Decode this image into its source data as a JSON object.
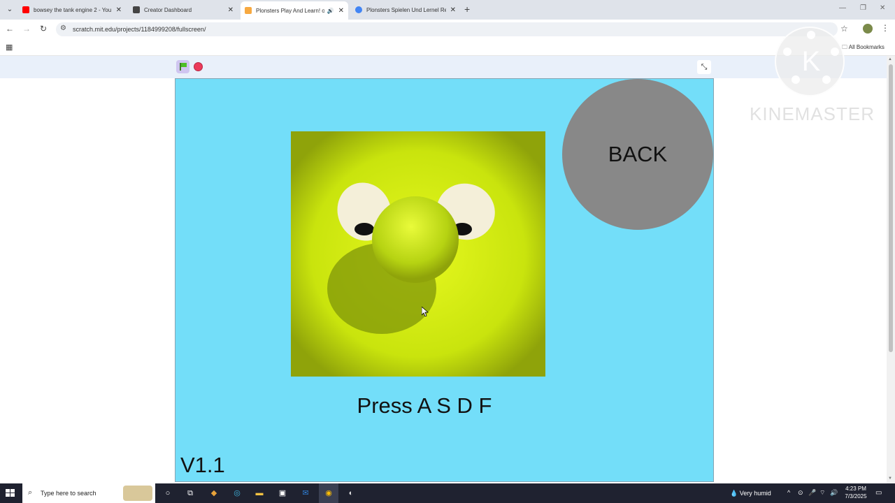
{
  "browser": {
    "tabs": [
      {
        "title": "bowsey the tank engine 2 - You",
        "favicon": "youtube-icon",
        "color": "#ff0000",
        "active": false
      },
      {
        "title": "Creator Dashboard",
        "favicon": "dashboard-icon",
        "color": "#444444",
        "active": false
      },
      {
        "title": "Plonsters Play And Learn! o",
        "favicon": "scratch-icon",
        "color": "#f7a941",
        "active": true,
        "audio": true
      },
      {
        "title": "Plonsters Spielen Und Lernel Re",
        "favicon": "google-icon",
        "color": "#4285f4",
        "active": false
      }
    ],
    "url": "scratch.mit.edu/projects/1184999208/fullscreen/",
    "bookmarks_label": "All Bookmarks"
  },
  "stage": {
    "back_label": "BACK",
    "instruction": "Press A S D F",
    "version": "V1.1",
    "background_color": "#73def9",
    "back_color": "#888888"
  },
  "watermark": {
    "brand": "KINEMASTER",
    "logo_letter": "K"
  },
  "taskbar": {
    "search_placeholder": "Type here to search",
    "weather": "Very humid",
    "time": "4:23 PM",
    "date": "7/3/2025"
  }
}
